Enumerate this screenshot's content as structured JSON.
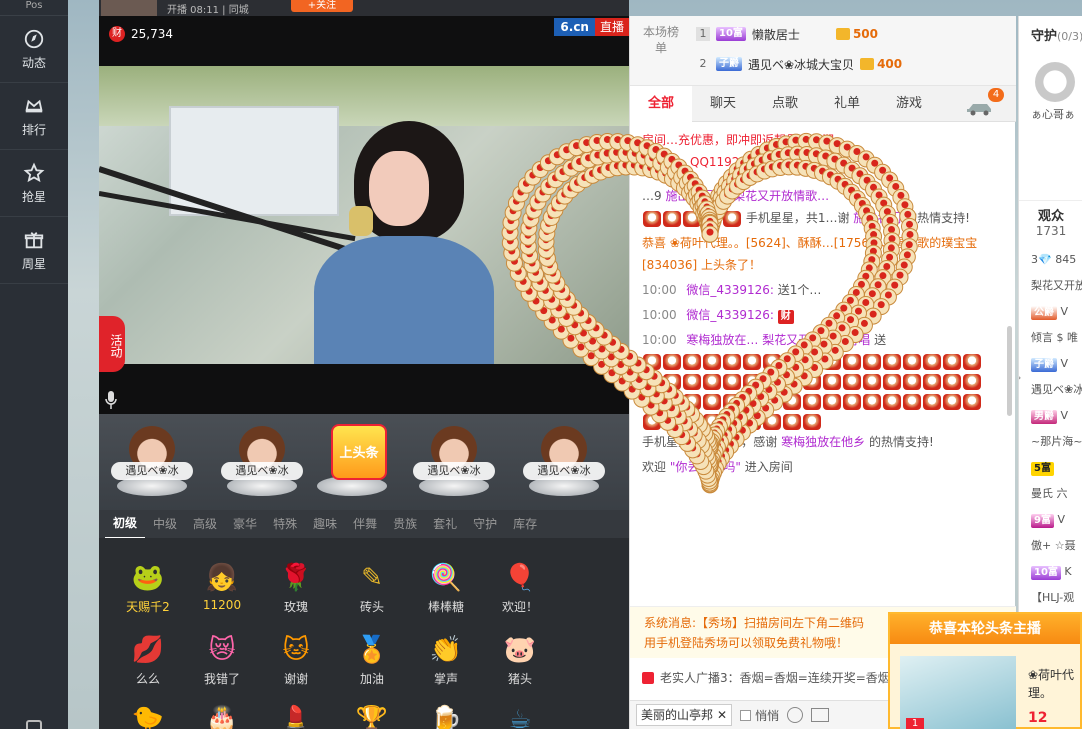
{
  "nav": {
    "top_text": "Pos",
    "items": [
      {
        "label": "动态",
        "icon": "compass-icon"
      },
      {
        "label": "排行",
        "icon": "crown-icon"
      },
      {
        "label": "抢星",
        "icon": "star-icon"
      },
      {
        "label": "周星",
        "icon": "gift-box-icon"
      }
    ]
  },
  "top_strip": {
    "text": "开播 08:11 | 同城",
    "follow_label": "+关注"
  },
  "video": {
    "coin_label": "财",
    "coin_count": "25,734",
    "brand_logo": "6.cn",
    "brand_live": "直播",
    "activity_label": "活动"
  },
  "stars": [
    {
      "name": "遇见ベ❀冰"
    },
    {
      "name": "遇见ベ❀冰"
    },
    {
      "headline": "上头条"
    },
    {
      "name": "遇见ベ❀冰"
    },
    {
      "name": "遇见ベ❀冰"
    }
  ],
  "gift_tabs": [
    "初级",
    "中级",
    "高级",
    "豪华",
    "特殊",
    "趣味",
    "伴舞",
    "贵族",
    "套礼",
    "守护",
    "库存"
  ],
  "gifts": [
    {
      "label": "天赐千2",
      "icon": "frog-crown-icon",
      "gold": true
    },
    {
      "label": "11200",
      "icon": "doll-icon",
      "gold": true
    },
    {
      "label": "玫瑰",
      "icon": "rose-icon"
    },
    {
      "label": "砖头",
      "icon": "brick-icon"
    },
    {
      "label": "棒棒糖",
      "icon": "lollipop-icon"
    },
    {
      "label": "欢迎！",
      "icon": "balloon-icon"
    },
    {
      "label": "么么",
      "icon": "kiss-lips-icon"
    },
    {
      "label": "我错了",
      "icon": "sorry-face-icon"
    },
    {
      "label": "谢谢",
      "icon": "thanks-cat-icon"
    },
    {
      "label": "加油",
      "icon": "cheer-badge-icon"
    },
    {
      "label": "掌声",
      "icon": "clap-icon"
    },
    {
      "label": "猪头",
      "icon": "pig-icon"
    }
  ],
  "rank": {
    "label": "本场榜单",
    "rows": [
      {
        "num": "1",
        "badge": "10富",
        "name": "懒散居士",
        "score": "500"
      },
      {
        "num": "2",
        "badge": "子爵",
        "name": "遇见ベ❀冰城大宝贝",
        "score": "400"
      }
    ]
  },
  "chat_tabs": [
    "全部",
    "聊天",
    "点歌",
    "礼单",
    "游戏"
  ],
  "car_badge": "4",
  "chat": {
    "m1": "房间…充优惠，即冲即返靓号出长期",
    "m1b": "…微信、QQ119207…",
    "m2_pre": "…9",
    "m2_from": "施出名门",
    "m2_to_word": "向",
    "m2_to": "梨花又开放情歌…",
    "m2_tail": "手机星星，共1…谢",
    "m2_thanks_user": "施出名门",
    "m2_end": "的热情支持!",
    "m3": "恭喜 ❀荷叶代理。。[5624]、酥酥…[17565]、唱老歌的璞宝宝[834036] 上头条了！",
    "m4_time": "10:00",
    "m4_user": "微信_4339126:",
    "m4_text": "送1个…",
    "m5_time": "10:00",
    "m5_user": "微信_4339126:",
    "m5_tag": "财",
    "m6_time": "10:00",
    "m6_user": "寒梅独放在…",
    "m6_to": "梨花又开放情歌对唱",
    "m6_send": "送",
    "m6_tail": "手机星星，共99个，感谢",
    "m6_thanks_user": "寒梅独放在他乡",
    "m6_end": "的热情支持!",
    "m7_pre": "欢迎",
    "m7_user": "\"你丢失了吗\"",
    "m7_end": "进入房间"
  },
  "system": {
    "line1": "系统消息:【秀场】扫描房间左下角二维码",
    "line2": "用手机登陆秀场可以领取免费礼物哦！"
  },
  "broadcast": "老实人广播3：香烟=香烟=连续开奖=香烟=",
  "input": {
    "target": "美丽的山亭邦",
    "whisper": "悄悄"
  },
  "right": {
    "guard_title": "守护",
    "guard_count": "(0/3)",
    "guard_name": "ぁ心哥ぁ",
    "audience_title": "观众",
    "audience_count": "1731",
    "audience": [
      {
        "badge": "",
        "text": "3💎 845"
      },
      {
        "badge": "",
        "text": "梨花又开放"
      },
      {
        "badge": "公爵",
        "text": "V"
      },
      {
        "badge": "",
        "text": "倾言 $ 唯"
      },
      {
        "badge": "子爵",
        "text": "V"
      },
      {
        "badge": "",
        "text": "遇见ベ❀冰"
      },
      {
        "badge": "男爵",
        "text": "V"
      },
      {
        "badge": "",
        "text": "~那片海~"
      },
      {
        "badge": "5富",
        "text": ""
      },
      {
        "badge": "",
        "text": "曼氏 六"
      },
      {
        "badge": "9富",
        "text": "V"
      },
      {
        "badge": "",
        "text": "傲+ ☆聂"
      },
      {
        "badge": "10富",
        "text": "K"
      },
      {
        "badge": "",
        "text": "【HLJ-观"
      },
      {
        "badge": "7富",
        "text": "85"
      }
    ]
  },
  "notice": {
    "title": "恭喜本轮头条主播",
    "who": "❀荷叶代理。",
    "rank": "1",
    "num": "12"
  },
  "colors": {
    "accent": "#e2232a",
    "nav_bg": "#2a2f36",
    "gold": "#f3b62b"
  }
}
